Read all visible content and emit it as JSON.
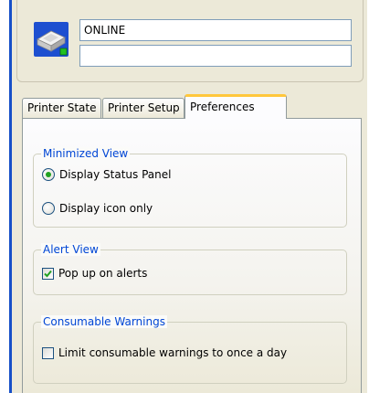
{
  "status": {
    "line1": "ONLINE",
    "line2": ""
  },
  "icons": {
    "printer": "printer-icon"
  },
  "tabs": [
    {
      "label": "Printer State",
      "active": false
    },
    {
      "label": "Printer Setup",
      "active": false
    },
    {
      "label": "Preferences",
      "active": true
    }
  ],
  "preferences": {
    "minimized_view": {
      "legend": "Minimized View",
      "options": [
        {
          "label": "Display Status Panel",
          "checked": true
        },
        {
          "label": "Display icon only",
          "checked": false
        }
      ]
    },
    "alert_view": {
      "legend": "Alert View",
      "option": {
        "label": "Pop up on alerts",
        "checked": true
      }
    },
    "consumable_warnings": {
      "legend": "Consumable Warnings",
      "option": {
        "label": "Limit consumable warnings to once a day",
        "checked": false
      }
    }
  },
  "colors": {
    "group_legend": "#0046d5",
    "active_tab_accent": "#ffc73c",
    "radio_dot": "#21a121",
    "frame_edge": "#1750c8"
  }
}
